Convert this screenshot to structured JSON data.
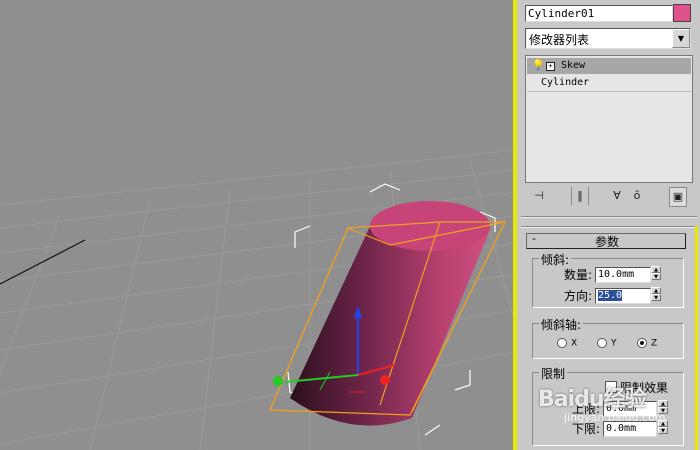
{
  "object": {
    "name": "Cylinder01",
    "color": "#e0508a"
  },
  "modifier_list": {
    "label": "修改器列表"
  },
  "stack": {
    "items": [
      {
        "label": "Skew"
      },
      {
        "label": "Cylinder"
      }
    ]
  },
  "toolbar": {
    "icons": [
      "pin-stack-icon",
      "show-end-result-icon",
      "make-unique-icon",
      "remove-modifier-icon",
      "configure-sets-icon"
    ]
  },
  "rollout": {
    "title": "参数",
    "skew_group": {
      "legend": "倾斜:",
      "amount_label": "数量:",
      "amount_value": "10.0mm",
      "direction_label": "方向:",
      "direction_value": "25.0"
    },
    "axis_group": {
      "legend": "倾斜轴:",
      "x_label": "X",
      "y_label": "Y",
      "z_label": "Z",
      "selected": "Z"
    },
    "limits_group": {
      "legend": "限制",
      "enable_label": "限制效果",
      "upper_label": "上限:",
      "upper_value": "0.0mm",
      "lower_label": "下限:",
      "lower_value": "0.0mm"
    }
  },
  "watermark": {
    "main": "Baidu经验",
    "sub": "jingyan.baidu.com"
  },
  "colors": {
    "viewport_bg": "#8f8f8f",
    "panel_bg": "#c8c8c8",
    "cylinder": "#e0508a",
    "bbox": "#f0a020",
    "active_separator": "#e8e800"
  }
}
